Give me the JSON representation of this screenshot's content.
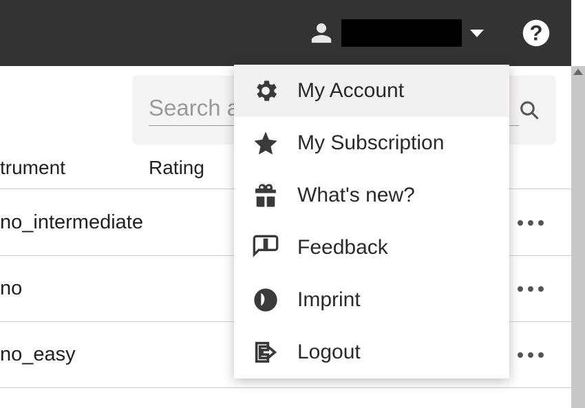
{
  "topbar": {
    "username": ""
  },
  "search": {
    "placeholder": "Search a"
  },
  "table": {
    "headers": {
      "instrument": "trument",
      "rating": "Rating"
    },
    "rows": [
      {
        "instrument": "no_intermediate"
      },
      {
        "instrument": "no"
      },
      {
        "instrument": "no_easy"
      }
    ]
  },
  "menu": {
    "items": [
      {
        "label": "My Account"
      },
      {
        "label": "My Subscription"
      },
      {
        "label": "What's new?"
      },
      {
        "label": "Feedback"
      },
      {
        "label": "Imprint"
      },
      {
        "label": "Logout"
      }
    ]
  }
}
